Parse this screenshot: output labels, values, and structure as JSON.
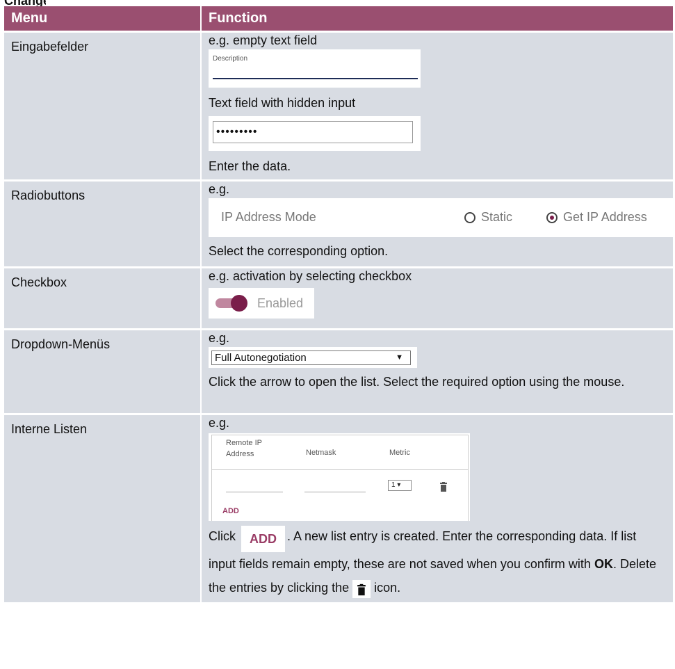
{
  "top_strip": "Changes",
  "table": {
    "headers": [
      "Menu",
      "Function"
    ],
    "rows": [
      {
        "menu": "Eingabefelder",
        "lines": [
          "e.g. empty text field",
          "Text field with hidden input",
          "Enter the data."
        ],
        "description_label": "Description",
        "password_mask": "•••••••••"
      },
      {
        "menu": "Radiobuttons",
        "lines": [
          "e.g.",
          "Select the corresponding option."
        ],
        "radio_label": "IP Address Mode",
        "options": [
          "Static",
          "Get IP Address"
        ],
        "selected": "Get IP Address"
      },
      {
        "menu": "Checkbox",
        "lines": [
          "e.g. activation by selecting checkbox"
        ],
        "toggle_label": "Enabled",
        "toggle_on": true
      },
      {
        "menu": "Dropdown-Menüs",
        "lines": [
          "e.g.",
          "Click the arrow to open the list. Select the required option using the mouse."
        ],
        "dropdown_value": "Full Autonegotiation"
      },
      {
        "menu": "Interne Listen",
        "lines": [
          "e.g."
        ],
        "list_headers": [
          "Remote IP",
          "Address",
          "Netmask",
          "Metric"
        ],
        "metric_value": "1",
        "add_label": "ADD",
        "text_click": "Click",
        "text_after_add": ". A new list entry is created. Enter the corresponding data. If list input fields remain empty, these are not saved when you confirm with",
        "ok": "OK",
        "text_after_ok": ". Delete the entries by clicking the",
        "text_icon": "icon."
      }
    ]
  },
  "colors": {
    "header_bg": "#9a4f70",
    "row_bg": "#d8dce3",
    "accent": "#7a1e4a"
  }
}
